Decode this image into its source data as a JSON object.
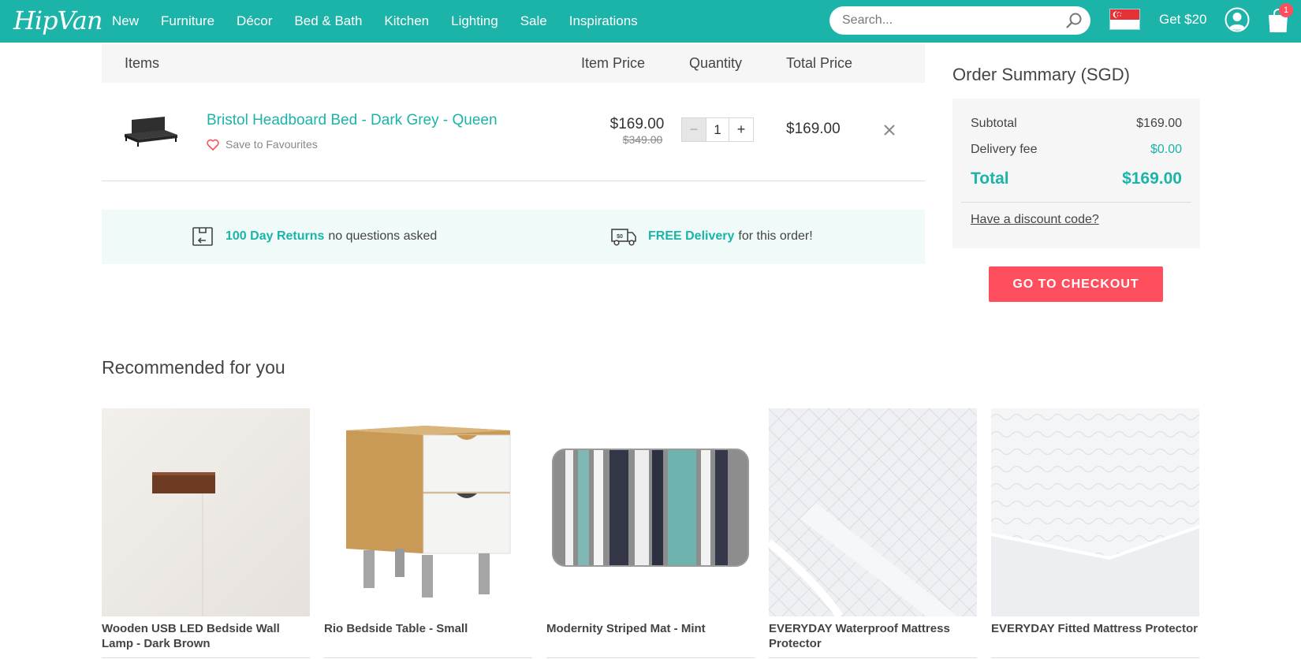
{
  "header": {
    "logo": "HipVan",
    "nav": [
      "New",
      "Furniture",
      "Décor",
      "Bed & Bath",
      "Kitchen",
      "Lighting",
      "Sale",
      "Inspirations"
    ],
    "search_placeholder": "Search...",
    "get_credit": "Get $20",
    "cart_count": "1",
    "brand_color": "#1cb3a8"
  },
  "cart": {
    "headers": {
      "items": "Items",
      "item_price": "Item Price",
      "quantity": "Quantity",
      "total_price": "Total Price"
    },
    "item": {
      "name": "Bristol Headboard Bed - Dark Grey - Queen",
      "save_label": "Save to Favourites",
      "price": "$169.00",
      "old_price": "$349.00",
      "quantity": "1",
      "total": "$169.00"
    }
  },
  "perks": {
    "returns_highlight": "100 Day Returns",
    "returns_text": "no questions asked",
    "delivery_highlight": "FREE Delivery",
    "delivery_text": "for this order!"
  },
  "summary": {
    "title": "Order Summary (SGD)",
    "subtotal_label": "Subtotal",
    "subtotal_value": "$169.00",
    "delivery_label": "Delivery fee",
    "delivery_value": "$0.00",
    "total_label": "Total",
    "total_value": "$169.00",
    "discount_link": "Have a discount code?",
    "checkout_button": "GO TO CHECKOUT",
    "checkout_color": "#ff4f5e"
  },
  "recommended": {
    "title": "Recommended for you",
    "items": [
      {
        "name": "Wooden USB LED Bedside Wall Lamp - Dark Brown"
      },
      {
        "name": "Rio Bedside Table - Small"
      },
      {
        "name": "Modernity Striped Mat - Mint"
      },
      {
        "name": "EVERYDAY Waterproof Mattress Protector"
      },
      {
        "name": "EVERYDAY Fitted Mattress Protector"
      }
    ]
  }
}
